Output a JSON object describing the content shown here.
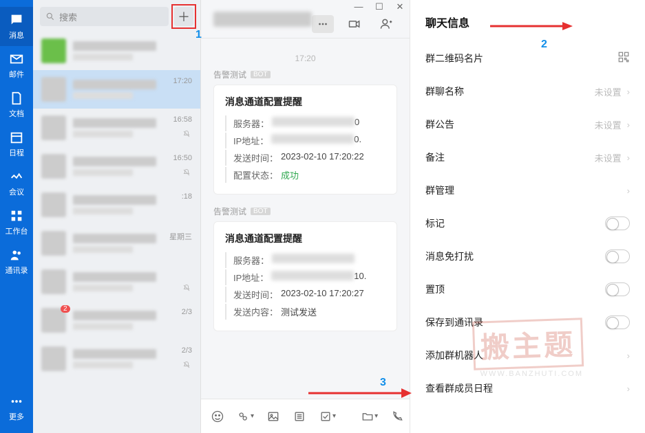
{
  "nav": {
    "items": [
      {
        "label": "消息",
        "icon": "chat"
      },
      {
        "label": "邮件",
        "icon": "mail"
      },
      {
        "label": "文档",
        "icon": "doc"
      },
      {
        "label": "日程",
        "icon": "calendar"
      },
      {
        "label": "会议",
        "icon": "meeting"
      },
      {
        "label": "工作台",
        "icon": "apps"
      },
      {
        "label": "通讯录",
        "icon": "contacts"
      },
      {
        "label": "更多",
        "icon": "more"
      }
    ]
  },
  "search": {
    "placeholder": "搜索"
  },
  "conversations": [
    {
      "time": "",
      "muted": false
    },
    {
      "time": "17:20",
      "selected": true
    },
    {
      "time": "16:58",
      "muted": true
    },
    {
      "time": "16:50",
      "muted": true
    },
    {
      "time": ":18",
      "muted": false
    },
    {
      "time": "星期三",
      "muted": false
    },
    {
      "time": "",
      "muted": true
    },
    {
      "time": "2/3",
      "badge": "2"
    },
    {
      "time": "2/3",
      "muted": true
    }
  ],
  "chat": {
    "time_divider": "17:20",
    "sender": "告警测试",
    "bot_tag": "BOT",
    "cards": [
      {
        "title": "消息通道配置提醒",
        "fields": [
          {
            "label": "服务器：",
            "blur": true,
            "tail": "0"
          },
          {
            "label": "IP地址：",
            "blur": true,
            "tail": "0."
          },
          {
            "label": "发送时间：",
            "value": "2023-02-10 17:20:22"
          },
          {
            "label": "配置状态：",
            "value": "成功",
            "success": true
          }
        ]
      },
      {
        "title": "消息通道配置提醒",
        "fields": [
          {
            "label": "服务器：",
            "blur": true,
            "tail": ""
          },
          {
            "label": "IP地址：",
            "blur": true,
            "tail": "10."
          },
          {
            "label": "发送时间：",
            "value": "2023-02-10 17:20:27"
          },
          {
            "label": "发送内容：",
            "value": "测试发送"
          }
        ]
      }
    ]
  },
  "info": {
    "title": "聊天信息",
    "rows": [
      {
        "label": "群二维码名片",
        "kind": "qr"
      },
      {
        "label": "群聊名称",
        "kind": "text",
        "value": "未设置"
      },
      {
        "label": "群公告",
        "kind": "text",
        "value": "未设置"
      },
      {
        "label": "备注",
        "kind": "text",
        "value": "未设置"
      },
      {
        "label": "群管理",
        "kind": "nav"
      },
      {
        "label": "标记",
        "kind": "toggle"
      },
      {
        "label": "消息免打扰",
        "kind": "toggle"
      },
      {
        "label": "置顶",
        "kind": "toggle"
      },
      {
        "label": "保存到通讯录",
        "kind": "toggle"
      },
      {
        "label": "添加群机器人",
        "kind": "nav"
      },
      {
        "label": "查看群成员日程",
        "kind": "nav"
      }
    ]
  },
  "annotations": {
    "n1": "1",
    "n2": "2",
    "n3": "3"
  },
  "watermark": {
    "text": "搬主题",
    "url": "WWW.BANZHUTI.COM"
  }
}
